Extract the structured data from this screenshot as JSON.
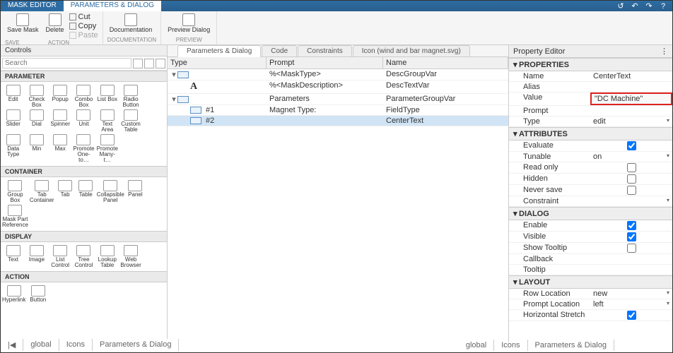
{
  "titlebar": {
    "tabs": [
      "MASK EDITOR",
      "PARAMETERS & DIALOG"
    ]
  },
  "ribbon": {
    "save": {
      "save_mask": "Save Mask",
      "delete": "Delete",
      "cut": "Cut",
      "copy": "Copy",
      "paste": "Paste",
      "label": "SAVE",
      "action_label": "ACTION"
    },
    "doc": {
      "btn": "Documentation",
      "label": "DOCUMENTATION"
    },
    "preview": {
      "btn": "Preview Dialog",
      "label": "PREVIEW"
    }
  },
  "left": {
    "header": "Controls",
    "search_placeholder": "Search",
    "sections": {
      "parameter": "PARAMETER",
      "container": "CONTAINER",
      "display": "DISPLAY",
      "action": "ACTION"
    },
    "parameter_items": [
      "Edit",
      "Check Box",
      "Popup",
      "Combo Box",
      "List Box",
      "Radio Button",
      "",
      "Slider",
      "Dial",
      "Spinner",
      "Unit",
      "Text Area",
      "Custom Table",
      "",
      "Data Type",
      "Min",
      "Max",
      "Promote One-to…",
      "Promote Many-t…",
      "",
      ""
    ],
    "container_items": [
      "Group Box",
      "Tab Container",
      "Tab",
      "Table",
      "Collapsible Panel",
      "Panel",
      "",
      "Mask Part Reference",
      "",
      "",
      "",
      "",
      "",
      ""
    ],
    "display_items": [
      "Text",
      "Image",
      "List Control",
      "Tree Control",
      "Lookup Table",
      "Web Browser",
      ""
    ],
    "action_items": [
      "Hyperlink",
      "Button",
      "",
      "",
      "",
      "",
      ""
    ]
  },
  "center": {
    "tabs": [
      "Parameters & Dialog",
      "Code",
      "Constraints",
      "Icon (wind and bar magnet.svg)"
    ],
    "headers": {
      "type": "Type",
      "prompt": "Prompt",
      "name": "Name"
    },
    "rows": [
      {
        "indent": 0,
        "icon": "folder",
        "expander": "▾",
        "type_label": "",
        "prompt": "%<MaskType>",
        "name": "DescGroupVar"
      },
      {
        "indent": 1,
        "icon": "A",
        "expander": "",
        "type_label": "",
        "prompt": "%<MaskDescription>",
        "name": "DescTextVar"
      },
      {
        "indent": 0,
        "icon": "folder",
        "expander": "▾",
        "type_label": "",
        "prompt": "Parameters",
        "name": "ParameterGroupVar"
      },
      {
        "indent": 1,
        "icon": "edit",
        "expander": "",
        "type_label": "#1",
        "prompt": "Magnet Type:",
        "name": "FieldType"
      },
      {
        "indent": 1,
        "icon": "edit",
        "expander": "",
        "type_label": "#2",
        "prompt": "",
        "name": "CenterText",
        "selected": true
      }
    ]
  },
  "right": {
    "header": "Property Editor",
    "groups": {
      "properties": "PROPERTIES",
      "attributes": "ATTRIBUTES",
      "dialog": "DIALOG",
      "layout": "LAYOUT"
    },
    "props": {
      "name": {
        "label": "Name",
        "value": "CenterText"
      },
      "alias": {
        "label": "Alias",
        "value": ""
      },
      "value": {
        "label": "Value",
        "value": "\"DC Machine\"",
        "highlight": true
      },
      "prompt": {
        "label": "Prompt",
        "value": ""
      },
      "type": {
        "label": "Type",
        "value": "edit",
        "dd": true
      }
    },
    "attrs": {
      "evaluate": {
        "label": "Evaluate",
        "checked": true
      },
      "tunable": {
        "label": "Tunable",
        "value": "on",
        "dd": true
      },
      "readonly": {
        "label": "Read only",
        "checked": false
      },
      "hidden": {
        "label": "Hidden",
        "checked": false
      },
      "neversave": {
        "label": "Never save",
        "checked": false
      },
      "constraint": {
        "label": "Constraint",
        "value": "",
        "dd": true
      }
    },
    "dialog": {
      "enable": {
        "label": "Enable",
        "checked": true
      },
      "visible": {
        "label": "Visible",
        "checked": true
      },
      "tooltip_show": {
        "label": "Show Tooltip",
        "checked": false
      },
      "callback": {
        "label": "Callback",
        "value": ""
      },
      "tooltip": {
        "label": "Tooltip",
        "value": ""
      }
    },
    "layout": {
      "rowloc": {
        "label": "Row Location",
        "value": "new",
        "dd": true
      },
      "promptloc": {
        "label": "Prompt Location",
        "value": "left",
        "dd": true
      },
      "hstretch": {
        "label": "Horizontal Stretch",
        "checked": true
      }
    }
  },
  "status": {
    "left": [
      "global",
      "Icons",
      "Parameters & Dialog"
    ],
    "right": [
      "global",
      "Icons",
      "Parameters & Dialog"
    ]
  }
}
